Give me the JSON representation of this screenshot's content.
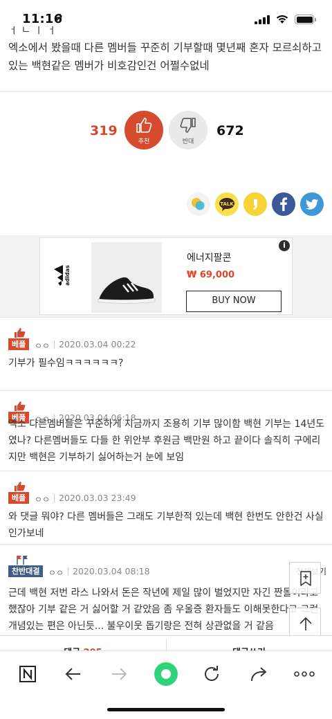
{
  "status_bar": {
    "time": "11:16",
    "location_arrow": "location-arrow-icon"
  },
  "article": {
    "cut_line": "ㅓ ㄴ ㅣ ㅓ",
    "text": "엑소에서 봤을때 다른 멤버들 꾸준히 기부할때 몇년째 혼자 모르쇠하고있는 백현같은 멤버가 비호감인건 어쩔수없네"
  },
  "vote": {
    "up_count": "319",
    "up_label": "추천",
    "down_label": "반대",
    "down_count": "672"
  },
  "share": [
    "kakaostory-icon",
    "kakaotalk-icon",
    "band-icon",
    "facebook-icon",
    "twitter-icon"
  ],
  "ad": {
    "brand": "adidas",
    "product_name": "에너지팔콘",
    "price": "₩ 69,000",
    "button": "BUY NOW",
    "info": "i"
  },
  "comments": [
    {
      "badge": "베플",
      "badge_type": "best",
      "author": "ㅇㅇ",
      "date": "2020.03.04 00:22",
      "text": "기부가 필수임ㅋㅋㅋㅋㅋㅋ?"
    },
    {
      "badge": "베플",
      "badge_type": "best",
      "author": "ㅇㅇ",
      "date": "2020.03.04 06:18",
      "text": "엑소 다른멤버들은 꾸준하게 지금까지 조용히 기부 많이함 백현 기부는 14년도였나? 다른멤버들도 다들 한 위안부 후원금 백만원 하고 끝이다 솔직히 구에리지만 백현은 기부하기 싫어하는거 눈에 보임"
    },
    {
      "badge": "베플",
      "badge_type": "best",
      "author": "ㅇㅇ",
      "date": "2020.03.03 23:49",
      "text": "와 댓글 뭐야? 다른 멤버들은 그래도 기부한적 있는데 백현 한번도 안한건 사실인가보네"
    },
    {
      "badge": "찬반대결",
      "badge_type": "pro",
      "author": "ㅇㅇ",
      "date": "2020.03.04 08:18",
      "view_all": "전체보기",
      "text": "근데 백현 저번 라스 나와서 돈은 작년에 제일 많이 벌었지만 자긴 짠돌이라고 했잖아 기부 같은 거 싫어할 거 같았음 좀 우울증 환자들도 이해못한다고 그런 개념있는 편은 아닌듯... 불우이웃 돕기랑은 전혀 상관없을 거 같음"
    }
  ],
  "comment_bar": {
    "left_label": "댓글",
    "left_count": "295",
    "right_label": "댓글쓰기"
  },
  "floating": [
    "bookmark-add-icon",
    "scroll-top-icon"
  ],
  "toolbar": [
    "naver-icon",
    "back-icon",
    "forward-icon",
    "green-dot-icon",
    "refresh-icon",
    "share-icon",
    "more-icon"
  ],
  "colors": {
    "accent": "#d64a2e",
    "pro_badge": "#3f5d8a"
  }
}
